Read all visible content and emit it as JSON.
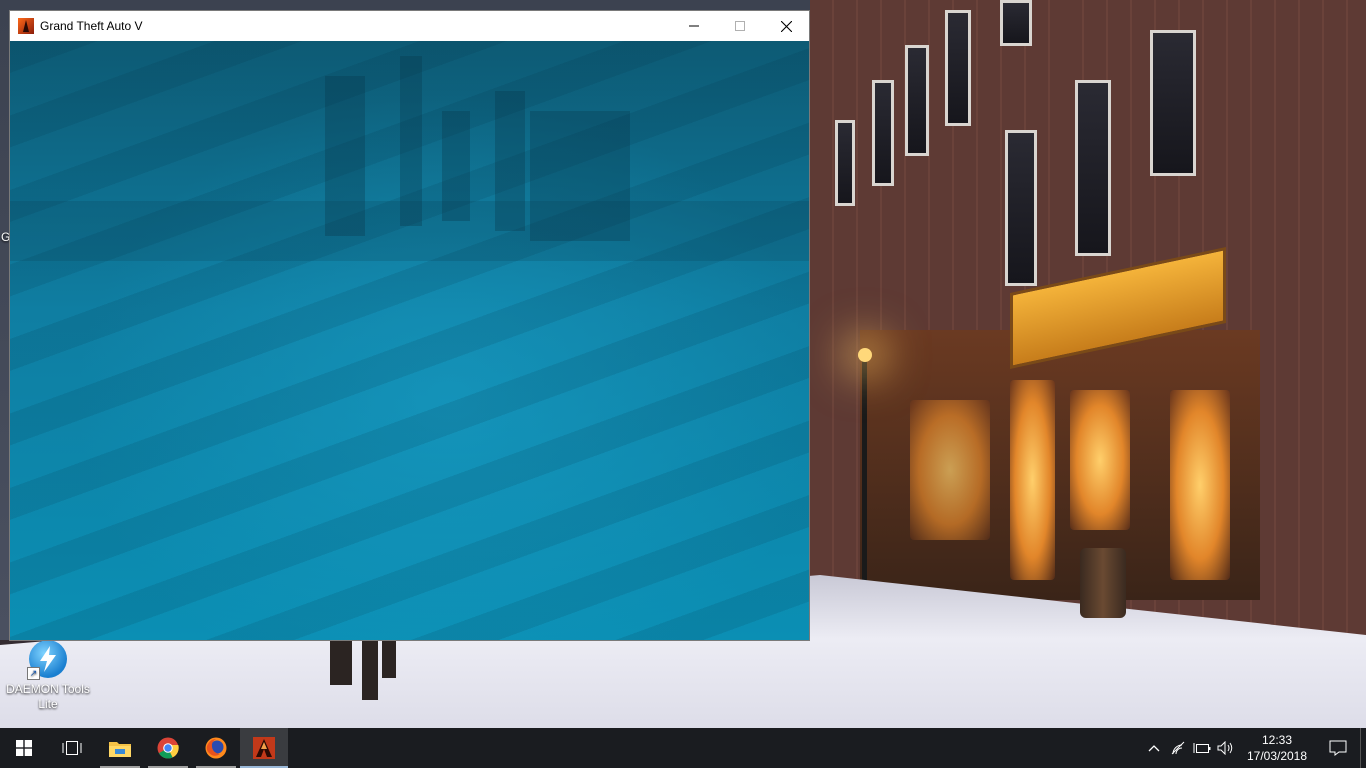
{
  "window": {
    "title": "Grand Theft Auto V",
    "controls": [
      "minimize",
      "maximize",
      "close"
    ],
    "background_color": "#0e7ea2"
  },
  "desktop": {
    "icons": [
      {
        "label": "DAEMON Tools Lite",
        "icon": "daemon-tools-icon"
      }
    ],
    "edge_text": "G"
  },
  "taskbar": {
    "pinned": [
      {
        "name": "start",
        "icon": "windows-logo-icon"
      },
      {
        "name": "task-view",
        "icon": "task-view-icon"
      },
      {
        "name": "file-explorer",
        "icon": "folder-icon"
      },
      {
        "name": "chrome",
        "icon": "chrome-icon"
      },
      {
        "name": "firefox",
        "icon": "firefox-icon"
      },
      {
        "name": "gta-v",
        "icon": "gta-v-icon",
        "active": true
      }
    ],
    "tray": {
      "icons": [
        "chevron-up-icon",
        "network-icon",
        "battery-icon",
        "volume-icon"
      ],
      "time": "12:33",
      "date": "17/03/2018"
    }
  },
  "colors": {
    "taskbar": "#1a1c20",
    "titlebar": "#ffffff",
    "accent": "#9ab8d8"
  }
}
